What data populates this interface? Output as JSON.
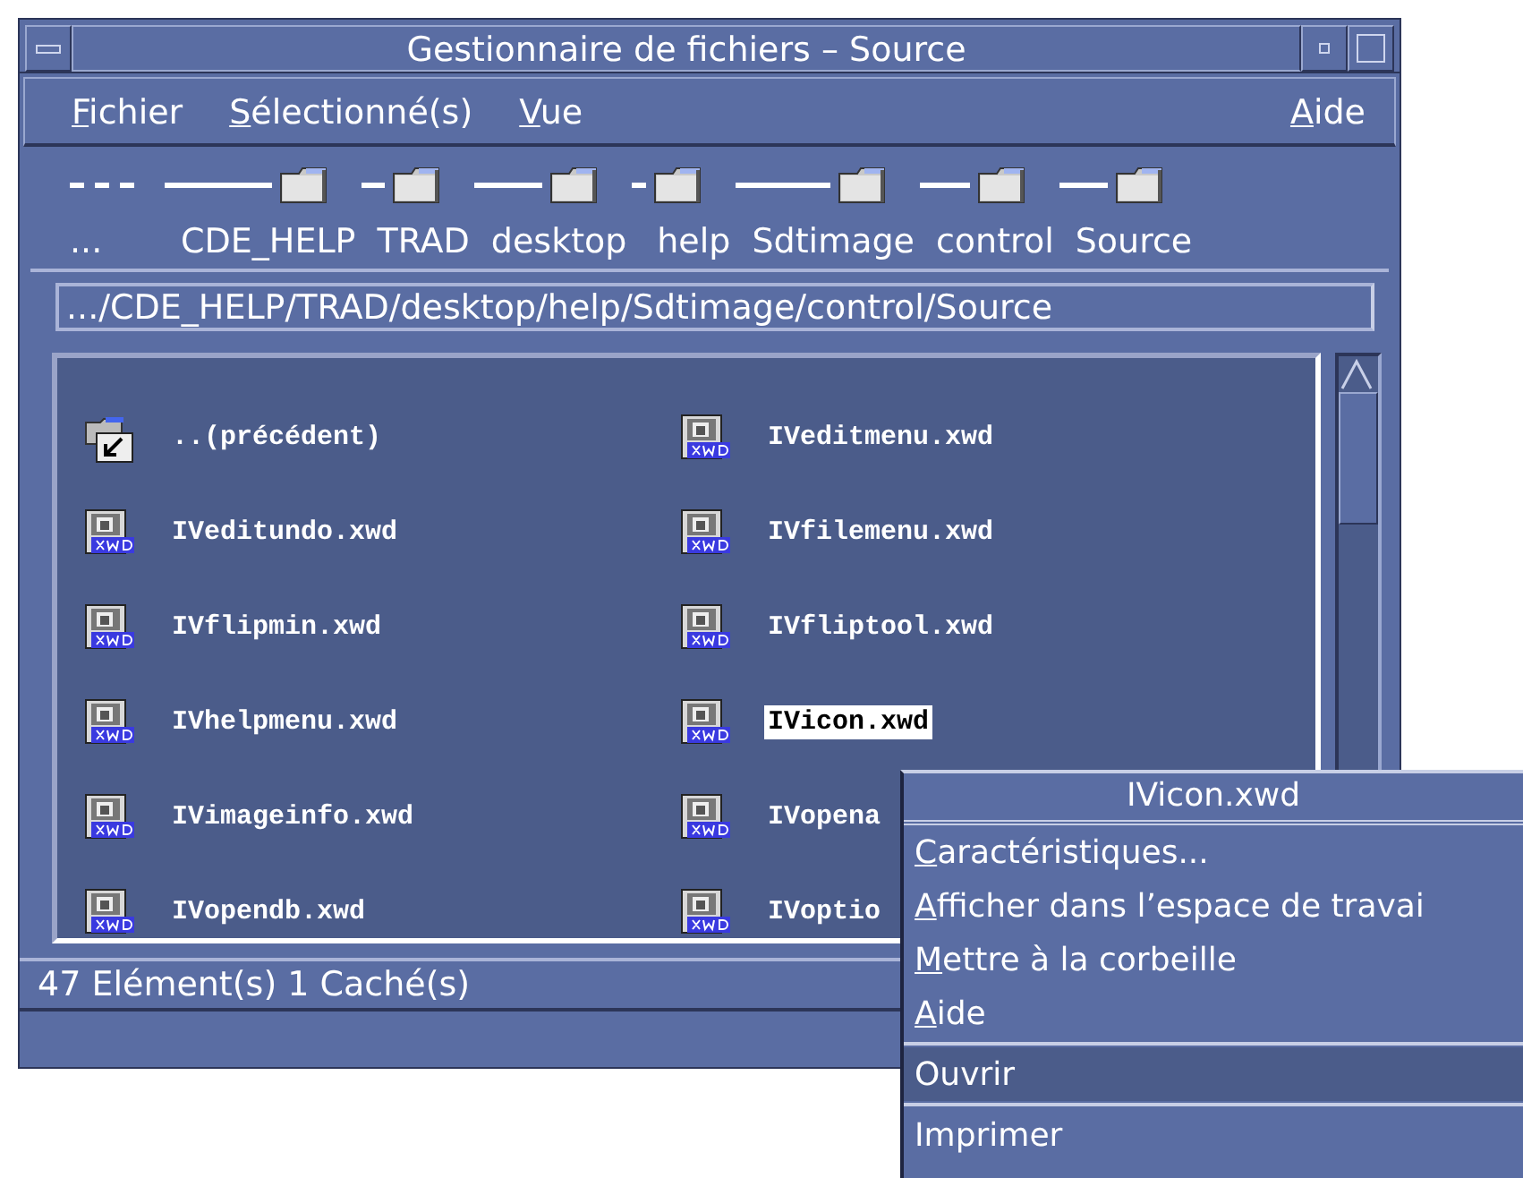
{
  "window": {
    "title": "Gestionnaire de fichiers – Source"
  },
  "menu_bar": {
    "left": [
      {
        "label": "Fichier",
        "mnemonic": true
      },
      {
        "label": "Sélectionné(s)",
        "mnemonic": true
      },
      {
        "label": "Vue",
        "mnemonic": true
      }
    ],
    "right": [
      {
        "label": "Aide",
        "mnemonic": true
      }
    ]
  },
  "path_bar": [
    {
      "label": "...",
      "kind": "ellipsis"
    },
    {
      "label": "CDE_HELP",
      "kind": "folder"
    },
    {
      "label": "TRAD",
      "kind": "folder"
    },
    {
      "label": "desktop",
      "kind": "folder"
    },
    {
      "label": "help",
      "kind": "folder"
    },
    {
      "label": "Sdtimage",
      "kind": "folder"
    },
    {
      "label": "control",
      "kind": "folder"
    },
    {
      "label": "Source",
      "kind": "folder"
    }
  ],
  "path_field": {
    "value": ".../CDE_HELP/TRAD/desktop/help/Sdtimage/control/Source"
  },
  "files": [
    {
      "name": "..(précédent)",
      "kind": "parent",
      "selected": false
    },
    {
      "name": "IVeditmenu.xwd",
      "kind": "xwd",
      "selected": false
    },
    {
      "name": "IVeditundo.xwd",
      "kind": "xwd",
      "selected": false
    },
    {
      "name": "IVfilemenu.xwd",
      "kind": "xwd",
      "selected": false
    },
    {
      "name": "IVflipmin.xwd",
      "kind": "xwd",
      "selected": false
    },
    {
      "name": "IVfliptool.xwd",
      "kind": "xwd",
      "selected": false
    },
    {
      "name": "IVhelpmenu.xwd",
      "kind": "xwd",
      "selected": false
    },
    {
      "name": "IVicon.xwd",
      "kind": "xwd",
      "selected": true
    },
    {
      "name": "IVimageinfo.xwd",
      "kind": "xwd",
      "selected": false
    },
    {
      "name": "IVopena",
      "kind": "xwd",
      "selected": false
    },
    {
      "name": "IVopendb.xwd",
      "kind": "xwd",
      "selected": false
    },
    {
      "name": "IVoptio",
      "kind": "xwd",
      "selected": false
    }
  ],
  "status_bar": "47 Elément(s) 1 Caché(s)",
  "context_menu": {
    "title": "IVicon.xwd",
    "items": [
      {
        "label": "Caractéristiques...",
        "mnemonic": true,
        "selected": false,
        "separator_before": false
      },
      {
        "label": "Afficher dans l’espace de travai",
        "mnemonic": true,
        "selected": false,
        "separator_before": false
      },
      {
        "label": "Mettre à la corbeille",
        "mnemonic": true,
        "selected": false,
        "separator_before": false
      },
      {
        "label": "Aide",
        "mnemonic": true,
        "selected": false,
        "separator_before": false
      },
      {
        "label": "Ouvrir",
        "mnemonic": false,
        "selected": true,
        "separator_before": true
      },
      {
        "label": "Imprimer",
        "mnemonic": false,
        "selected": false,
        "separator_before": true
      }
    ]
  }
}
